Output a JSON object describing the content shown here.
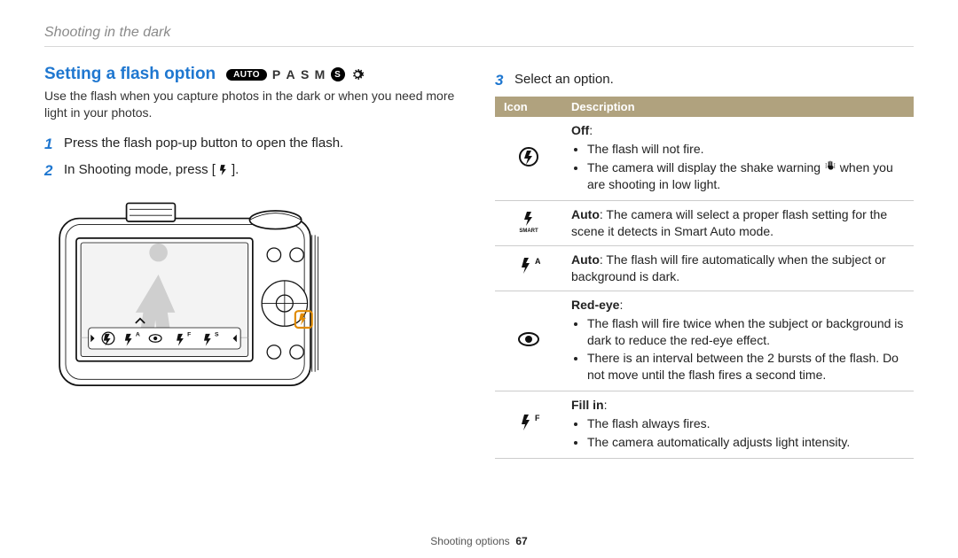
{
  "breadcrumb": "Shooting in the dark",
  "heading": "Setting a flash option",
  "modes": {
    "auto": "AUTO",
    "p": "P",
    "a": "A",
    "s": "S",
    "m": "M",
    "sbadge": "S"
  },
  "intro": "Use the flash when you capture photos in the dark or when you need more light in your photos.",
  "steps": {
    "s1": {
      "num": "1",
      "text": "Press the flash pop-up button to open the flash."
    },
    "s2": {
      "num": "2",
      "text_a": "In Shooting mode, press [",
      "text_b": "]."
    },
    "s3": {
      "num": "3",
      "text": "Select an option."
    }
  },
  "table": {
    "hdr_icon": "Icon",
    "hdr_desc": "Description",
    "rows": {
      "off": {
        "title": "Off",
        "b1": "The flash will not fire.",
        "b2_a": "The camera will display the shake warning ",
        "b2_b": " when you are shooting in low light."
      },
      "smart": {
        "title": "Auto",
        "rest": ": The camera will select a proper flash setting for the scene it detects in Smart Auto mode."
      },
      "autoA": {
        "title": "Auto",
        "rest": ": The flash will fire automatically when the subject or background is dark."
      },
      "redeye": {
        "title": "Red-eye",
        "b1": "The flash will fire twice when the subject or background is dark to reduce the red-eye effect.",
        "b2": "There is an interval between the 2 bursts of the flash. Do not move until the flash fires a second time."
      },
      "fillin": {
        "title": "Fill in",
        "b1": "The flash always fires.",
        "b2": "The camera automatically adjusts light intensity."
      }
    }
  },
  "footer": {
    "section": "Shooting options",
    "page": "67"
  }
}
